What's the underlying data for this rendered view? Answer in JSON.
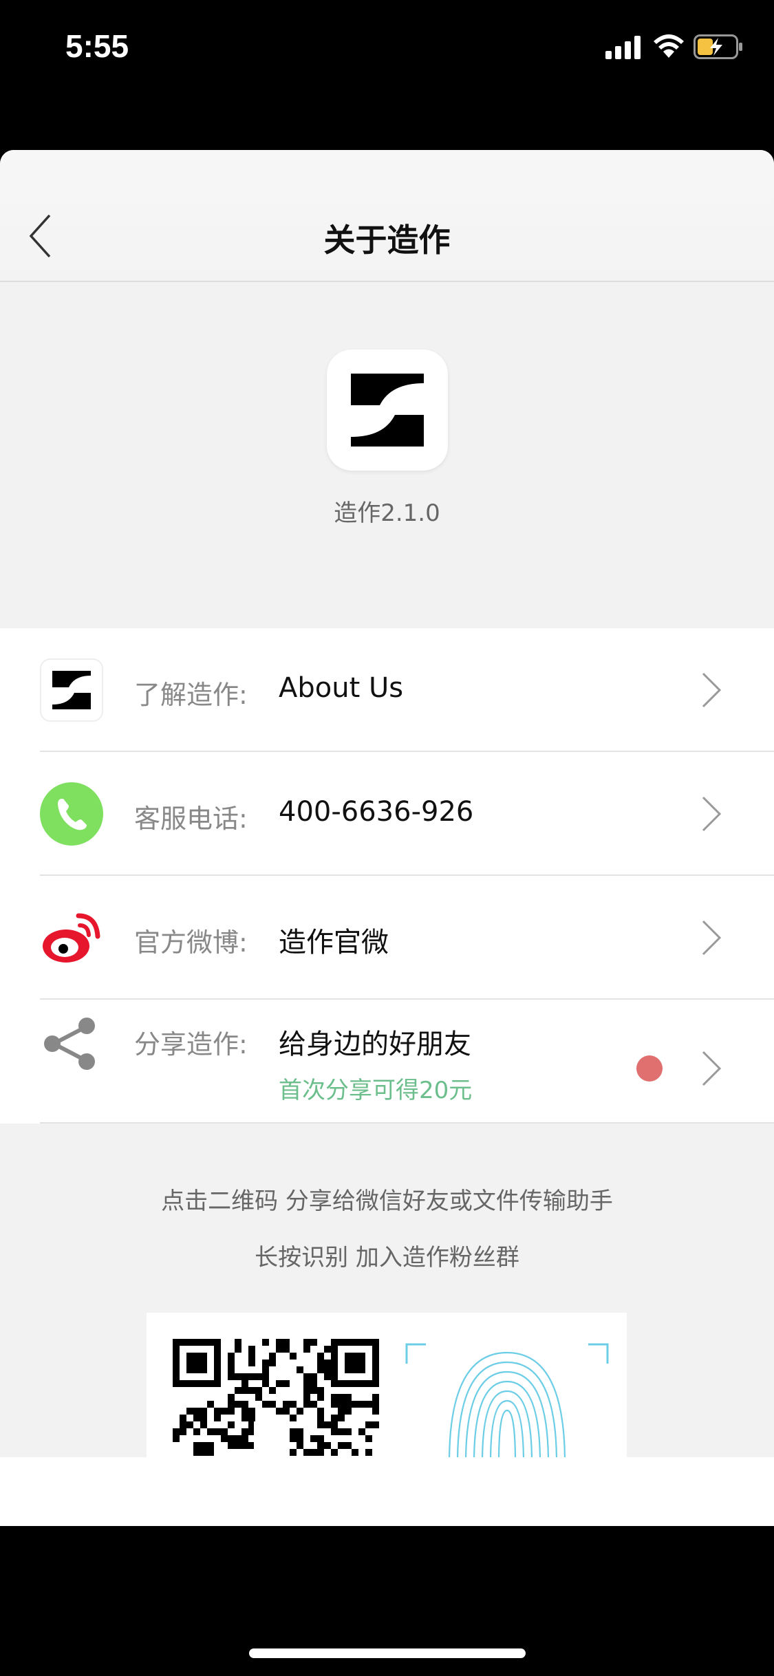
{
  "status_bar": {
    "time": "5:55"
  },
  "nav": {
    "title": "关于造作"
  },
  "app": {
    "version_text": "造作2.1.0"
  },
  "rows": [
    {
      "label": "了解造作:",
      "value": "About Us"
    },
    {
      "label": "客服电话:",
      "value": "400-6636-926"
    },
    {
      "label": "官方微博:",
      "value": "造作官微"
    },
    {
      "label": "分享造作:",
      "value": "给身边的好朋友",
      "sub": "首次分享可得20元"
    }
  ],
  "hints": {
    "line1": "点击二维码 分享给微信好友或文件传输助手",
    "line2": "长按识别 加入造作粉丝群"
  },
  "colors": {
    "phone_green": "#7ee05e",
    "weibo_red": "#e6162d",
    "sub_green": "#6cbf8c",
    "badge_red": "#e07070",
    "fingerprint_blue": "#6ccde6"
  }
}
